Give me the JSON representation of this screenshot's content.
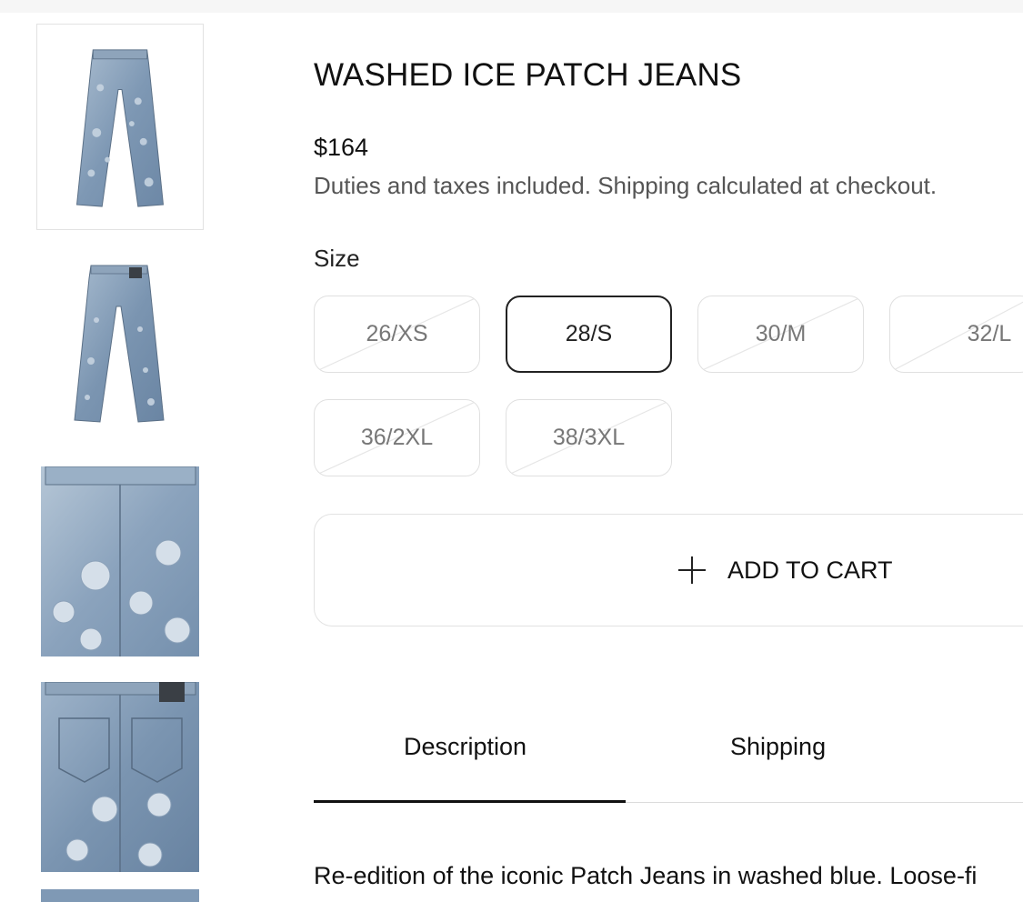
{
  "product": {
    "title": "WASHED ICE PATCH JEANS",
    "price": "$164",
    "tax_note": "Duties and taxes included. Shipping calculated at checkout."
  },
  "gallery": {
    "thumbnails": [
      {
        "name": "front-view",
        "selected": true
      },
      {
        "name": "back-view",
        "selected": false
      },
      {
        "name": "front-detail",
        "selected": false
      },
      {
        "name": "back-detail",
        "selected": false
      },
      {
        "name": "partial-thumb",
        "selected": false
      }
    ],
    "denim_color": "#7e98b4"
  },
  "size": {
    "label": "Size",
    "options": [
      {
        "label": "26/XS",
        "available": false
      },
      {
        "label": "28/S",
        "available": true,
        "selected": true
      },
      {
        "label": "30/M",
        "available": false
      },
      {
        "label": "32/L",
        "available": false
      },
      {
        "label": "36/2XL",
        "available": false
      },
      {
        "label": "38/3XL",
        "available": false
      }
    ]
  },
  "cart": {
    "add_label": "ADD TO CART",
    "icon": "plus-icon"
  },
  "tabs": {
    "items": [
      {
        "label": "Description",
        "active": true
      },
      {
        "label": "Shipping",
        "active": false
      }
    ]
  },
  "description": {
    "text": "Re-edition of the iconic Patch Jeans in washed blue. Loose-fi"
  },
  "colors": {
    "text": "#111111",
    "muted": "#555555",
    "border": "#e0e0e0",
    "active_border": "#222222"
  }
}
